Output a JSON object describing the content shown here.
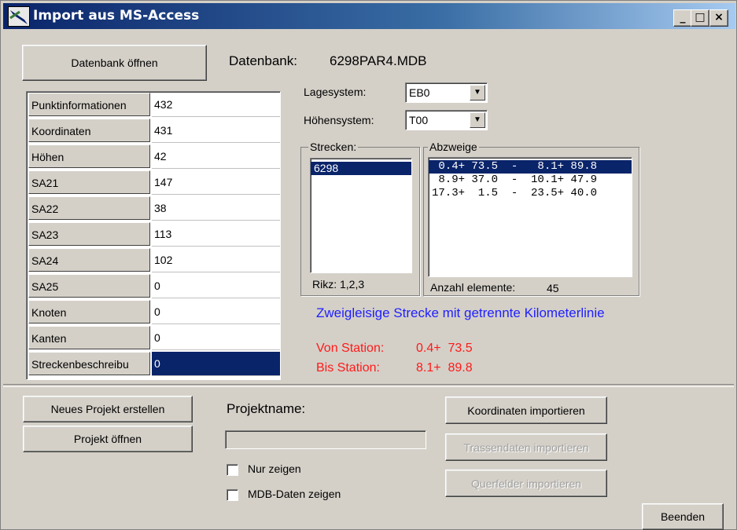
{
  "window": {
    "title": "Import aus MS-Access"
  },
  "header": {
    "open_db_label": "Datenbank öffnen",
    "db_label": "Datenbank:",
    "db_value": "6298PAR4.MDB"
  },
  "grid": {
    "rows": [
      {
        "label": "Punktinformationen",
        "value": "432"
      },
      {
        "label": "Koordinaten",
        "value": "431"
      },
      {
        "label": "Höhen",
        "value": "42"
      },
      {
        "label": "SA21",
        "value": "147"
      },
      {
        "label": "SA22",
        "value": "38"
      },
      {
        "label": "SA23",
        "value": "113"
      },
      {
        "label": "SA24",
        "value": "102"
      },
      {
        "label": "SA25",
        "value": "0"
      },
      {
        "label": "Knoten",
        "value": "0"
      },
      {
        "label": "Kanten",
        "value": "0"
      },
      {
        "label": "Streckenbeschreibu",
        "value": "0"
      }
    ]
  },
  "lagesystem": {
    "label": "Lagesystem:",
    "value": "EB0"
  },
  "hoehensystem": {
    "label": "Höhensystem:",
    "value": "T00"
  },
  "strecken": {
    "title": "Strecken:",
    "items": [
      "6298"
    ],
    "rikz": "Rikz: 1,2,3"
  },
  "abzweige": {
    "title": "Abzweige",
    "items": [
      " 0.4+ 73.5  -   8.1+ 89.8",
      " 8.9+ 37.0  -  10.1+ 47.9",
      "17.3+  1.5  -  23.5+ 40.0"
    ],
    "count_label": "Anzahl elemente:",
    "count_value": "45"
  },
  "info": {
    "description": "Zweigleisige Strecke mit getrennte Kilometerlinie",
    "von_label": "Von Station:",
    "von_value": "0.4+  73.5",
    "bis_label": "Bis Station:",
    "bis_value": "8.1+  89.8"
  },
  "bottom": {
    "new_project": "Neues Projekt erstellen",
    "open_project": "Projekt öffnen",
    "projectname_label": "Projektname:",
    "projectname_value": "",
    "only_show": "Nur zeigen",
    "mdb_show": "MDB-Daten zeigen",
    "import_coords": "Koordinaten importieren",
    "import_trasse": "Trassendaten importieren",
    "import_quer": "Querfelder importieren",
    "quit": "Beenden"
  },
  "colors": {
    "title_start": "#0a246a",
    "selection": "#0a246a",
    "info_blue": "#1f1fff",
    "info_red": "#ff1a1a"
  }
}
